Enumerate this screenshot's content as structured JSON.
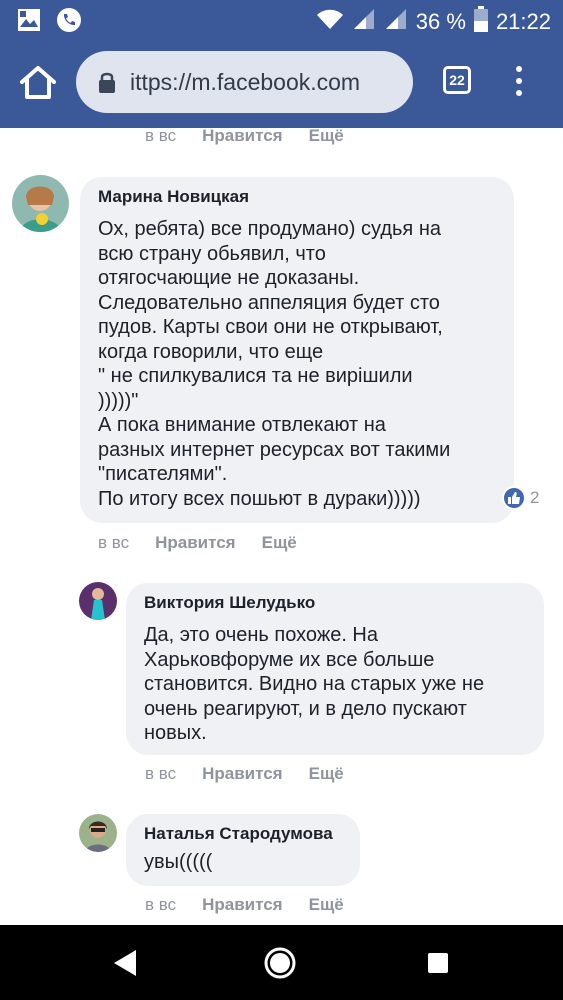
{
  "status_bar": {
    "battery": "36 %",
    "time": "21:22",
    "icons": [
      "gallery-icon",
      "phone-icon",
      "wifi-icon",
      "signal-icon",
      "signal-icon",
      "battery-icon"
    ]
  },
  "browser": {
    "url": "ittps://m.facebook.com",
    "tab_count": "22"
  },
  "top_meta": {
    "time": "в вс",
    "like": "Нравится",
    "more": "Ещё"
  },
  "comments": [
    {
      "author": "Марина Новицкая",
      "text": "Ох, ребята) все продумано) судья на\nвсю страну обьявил, что\nотягосчающие не доказаны.\nСледовательно аппеляция будет сто\nпудов. Карты свои они не открывают,\nкогда говорили, что еще\n\" не спилкувалися та не вирішили\n)))))\"\nА пока внимание отвлекают на\nразных интернет ресурсах вот такими\n\"писателями\".\nПо итогу всех пошьют в дураки)))))",
      "reaction_count": "2",
      "time": "в вс",
      "like": "Нравится",
      "more": "Ещё"
    },
    {
      "author": "Виктория Шелудько",
      "text": "Да, это очень похоже. На\nХарьковфоруме их все больше\nстановится. Видно на старых уже не\nочень реагируют, и в дело пускают\nновых.",
      "time": "в вс",
      "like": "Нравится",
      "more": "Ещё"
    },
    {
      "author": "Наталья Стародумова",
      "text": "увы(((((",
      "time": "в вс",
      "like": "Нравится",
      "more": "Ещё"
    }
  ],
  "colors": {
    "facebook_blue": "#3b5998",
    "bubble": "#f0f1f4",
    "meta_gray": "#90949c",
    "like_blue": "#4267b2"
  }
}
